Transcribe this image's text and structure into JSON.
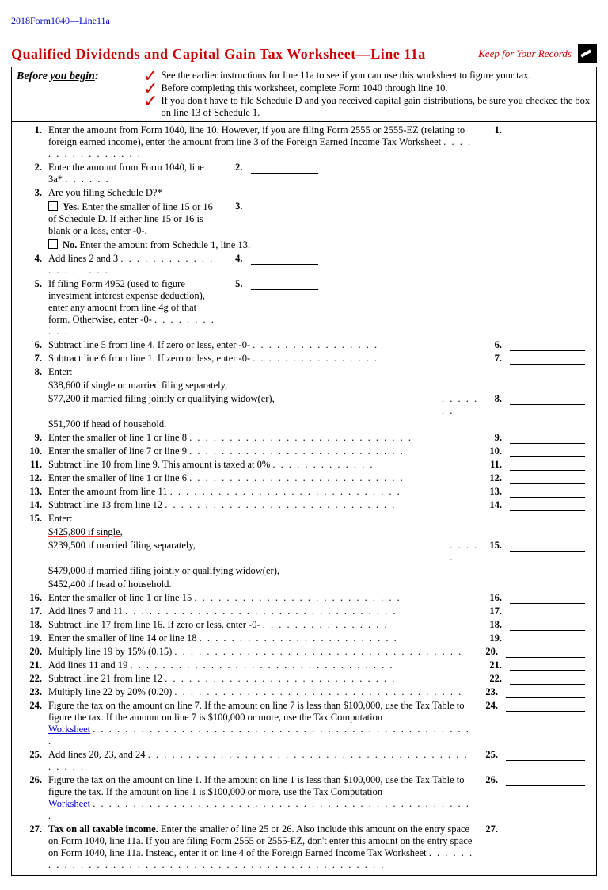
{
  "header_link": "2018Form1040—Line11a",
  "title": "Qualified Dividends and Capital Gain Tax Worksheet—Line 11a",
  "keep": "Keep for Your Records",
  "before_label_b": "Before",
  "before_label_u": "you begin",
  "before_colon": ":",
  "before": {
    "l1": "See the earlier instructions for line 11a to see if you can use this worksheet to figure your tax.",
    "l2": "Before completing this worksheet, complete Form 1040 through line 10.",
    "l3": "If you don't have to file Schedule D and you received capital gain distributions, be sure you checked the box on line 13 of Schedule 1."
  },
  "rows": {
    "r1": "Enter the amount from Form 1040, line 10. However, if you are filing Form 2555 or 2555-EZ (relating to foreign earned income), enter the amount from line 3 of the Foreign Earned Income Tax Worksheet",
    "r2": "Enter the amount from Form 1040, line 3a*",
    "r3": "Are you filing Schedule D?*",
    "r3yes1": "Yes.",
    "r3yes2": "Enter the smaller of line 15 or 16 of Schedule D. If either line 15 or 16 is blank or a loss, enter -0-.",
    "r3no1": "No.",
    "r3no2": "Enter the amount from Schedule 1, line 13.",
    "r4": "Add lines 2 and 3",
    "r5": "If filing Form 4952 (used to figure investment interest expense deduction), enter any amount from line 4g of that form. Otherwise, enter -0-",
    "r6": "Subtract line 5 from line 4. If zero or less, enter -0-",
    "r7": "Subtract line 6 from line 1. If zero or less, enter -0-",
    "r8": "Enter:",
    "r8a": "$38,600 if single or married filing separately,",
    "r8b": "$77,200 if married filing jointly or qualifying widow(er),",
    "r8c": "$51,700 if head of household.",
    "r9": "Enter the smaller of line 1 or line 8",
    "r10": "Enter the smaller of line 7 or line 9",
    "r11": "Subtract line 10 from line 9. This amount is taxed at 0%",
    "r12": "Enter the smaller of line 1 or line 6",
    "r13": "Enter the amount from line 11",
    "r14": "Subtract line 13 from line 12",
    "r15": "Enter:",
    "r15a": "$425,800 if single,",
    "r15b": "$239,500 if married filing separately,",
    "r15c": "$479,000 if married filing jointly or qualifying widow(er),",
    "r15d": "$452,400 if head of household.",
    "r16": "Enter the smaller of line 1 or line 15",
    "r17": "Add lines 7 and 11",
    "r18": "Subtract line 17 from line 16. If zero or less, enter -0-",
    "r19": "Enter the smaller of line 14 or line 18",
    "r20": "Multiply line 19 by 15% (0.15)",
    "r21": "Add lines 11 and 19",
    "r22": "Subtract line 21 from line 12",
    "r23": "Multiply line 22 by 20% (0.20)",
    "r24a": "Figure the tax on the amount on line 7. If the amount on line 7 is less than $100,000, use the Tax Table to figure the tax. If the amount on line 7 is $100,000 or more, use the Tax Computation",
    "r24b": "Worksheet",
    "r25": "Add lines 20, 23, and 24",
    "r26a": "Figure the tax on the amount on line 1. If the amount on line 1 is less than $100,000, use the Tax Table to figure the tax. If the amount on line 1 is $100,000 or more, use the Tax Computation",
    "r26b": "Worksheet",
    "r27a": "Tax on all taxable income.",
    "r27b": "Enter the smaller of line 25 or 26. Also include this amount on the entry space on Form 1040, line 11a. If you are filing Form 2555 or 2555-EZ, don't enter this amount on the entry space on Form 1040, line 11a. Instead, enter it on line 4 of the Foreign Earned Income Tax Worksheet"
  },
  "n": {
    "n1": "1.",
    "n2": "2.",
    "n3": "3.",
    "n4": "4.",
    "n5": "5.",
    "n6": "6.",
    "n7": "7.",
    "n8": "8.",
    "n9": "9.",
    "n10": "10.",
    "n11": "11.",
    "n12": "12.",
    "n13": "13.",
    "n14": "14.",
    "n15": "15.",
    "n16": "16.",
    "n17": "17.",
    "n18": "18.",
    "n19": "19.",
    "n20": "20.",
    "n21": "21.",
    "n22": "22.",
    "n23": "23.",
    "n24": "24.",
    "n25": "25.",
    "n26": "26.",
    "n27": "27."
  }
}
